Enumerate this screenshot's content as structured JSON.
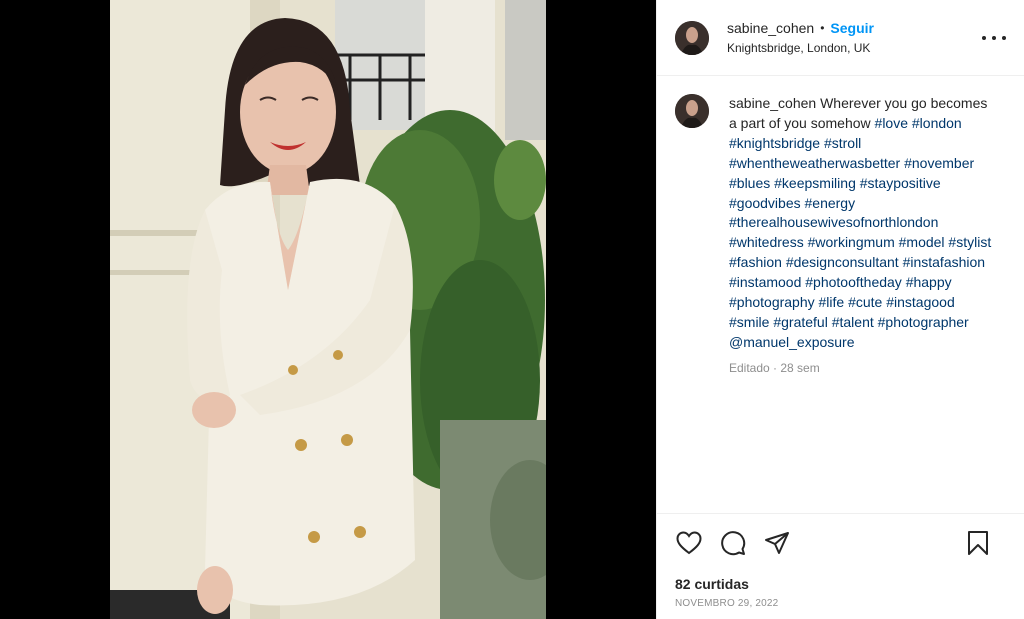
{
  "post": {
    "username": "sabine_cohen",
    "separator": "•",
    "follow_label": "Seguir",
    "location": "Knightsbridge, London, UK",
    "more_icon": "more-horizontal-icon"
  },
  "caption": {
    "username": "sabine_cohen",
    "text": "Wherever you go becomes a part of you somehow",
    "hashtags": "#love #london #knightsbridge #stroll #whentheweatherwasbetter #november #blues #keepsmiling #staypositive #goodvibes #energy #therealhousewivesofnorthlondon #whitedress #workingmum #model #stylist #fashion #designconsultant #instafashion #instamood #photooftheday #happy #photography #life #cute #instagood #smile #grateful #talent #photographer @manuel_exposure",
    "meta": "Editado · 28 sem"
  },
  "actions": {
    "icons": [
      "heart-icon",
      "comment-icon",
      "share-icon",
      "bookmark-icon"
    ],
    "likes_label": "82 curtidas",
    "date_label": "NOVEMBRO 29, 2022"
  },
  "colors": {
    "link": "#0095f6",
    "hashtag": "#00376b",
    "text": "#262626",
    "muted": "#8e8e8e"
  }
}
